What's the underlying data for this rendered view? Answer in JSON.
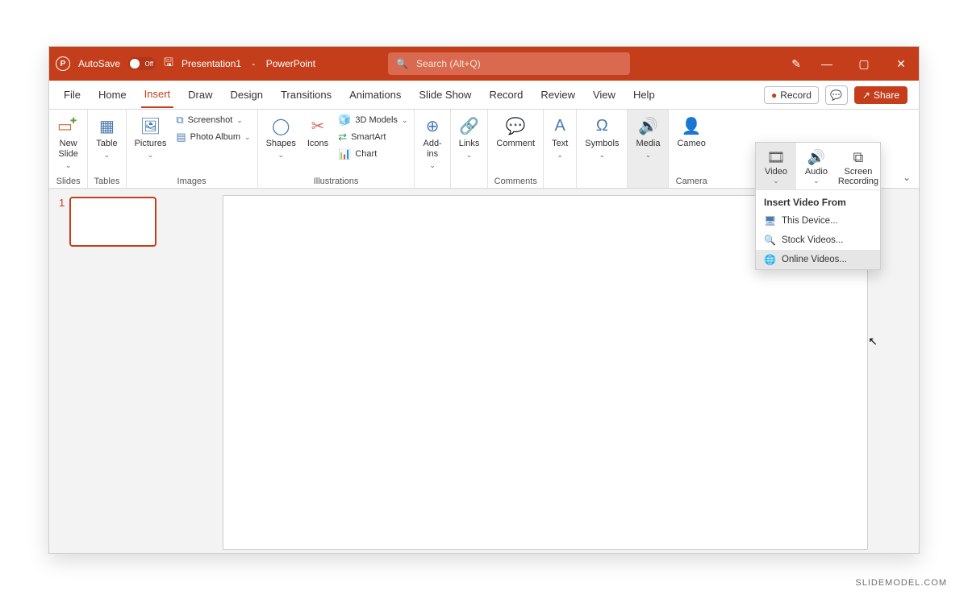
{
  "title": {
    "autosave": "AutoSave",
    "autosave_state": "Off",
    "docname": "Presentation1",
    "appname": "PowerPoint",
    "search_placeholder": "Search (Alt+Q)"
  },
  "tabs": {
    "file": "File",
    "home": "Home",
    "insert": "Insert",
    "draw": "Draw",
    "design": "Design",
    "transitions": "Transitions",
    "animations": "Animations",
    "slideshow": "Slide Show",
    "record": "Record",
    "review": "Review",
    "view": "View",
    "help": "Help",
    "record_btn": "Record",
    "share_btn": "Share"
  },
  "ribbon": {
    "slides": {
      "new_slide": "New\nSlide",
      "label": "Slides"
    },
    "tables": {
      "table": "Table",
      "label": "Tables"
    },
    "images": {
      "pictures": "Pictures",
      "screenshot": "Screenshot",
      "photo_album": "Photo Album",
      "label": "Images"
    },
    "illustrations": {
      "shapes": "Shapes",
      "icons": "Icons",
      "models3d": "3D Models",
      "smartart": "SmartArt",
      "chart": "Chart",
      "label": "Illustrations"
    },
    "addins": {
      "addins": "Add-\nins",
      "label": ""
    },
    "links": {
      "links": "Links",
      "label": ""
    },
    "comments": {
      "comment": "Comment",
      "label": "Comments"
    },
    "text": {
      "text": "Text",
      "label": ""
    },
    "symbols": {
      "symbols": "Symbols",
      "label": ""
    },
    "media": {
      "media": "Media",
      "label": ""
    },
    "camera": {
      "cameo": "Cameo",
      "label": "Camera"
    }
  },
  "dropdown": {
    "video": "Video",
    "audio": "Audio",
    "screenrec": "Screen\nRecording",
    "header": "Insert Video From",
    "this_device": "This Device...",
    "stock_videos": "Stock Videos...",
    "online_videos": "Online Videos..."
  },
  "thumb": {
    "num": "1"
  },
  "watermark": "SLIDEMODEL.COM"
}
